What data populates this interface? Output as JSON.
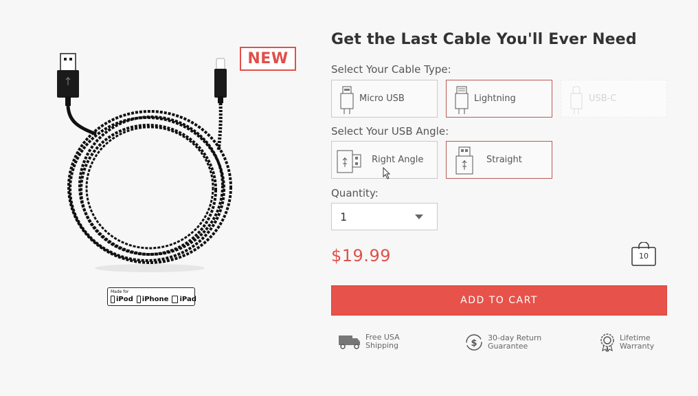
{
  "product": {
    "badge": "NEW",
    "mfi": {
      "small_text": "Made for",
      "ipod": "iPod",
      "iphone": "iPhone",
      "ipad": "iPad"
    },
    "title": "Get the Last Cable You'll Ever Need"
  },
  "cable_type": {
    "label": "Select Your Cable Type:",
    "options": [
      {
        "label": "Micro USB",
        "icon": "micro-usb-icon",
        "state": "normal"
      },
      {
        "label": "Lightning",
        "icon": "lightning-connector-icon",
        "state": "selected"
      },
      {
        "label": "USB-C",
        "icon": "usb-c-icon",
        "state": "disabled"
      }
    ]
  },
  "usb_angle": {
    "label": "Select Your USB Angle:",
    "options": [
      {
        "label": "Right Angle",
        "icon": "right-angle-usb-icon",
        "state": "normal"
      },
      {
        "label": "Straight",
        "icon": "straight-usb-icon",
        "state": "selected"
      }
    ]
  },
  "quantity": {
    "label": "Quantity:",
    "value": "1"
  },
  "price": "$19.99",
  "cart": {
    "count": "10"
  },
  "add_to_cart_label": "ADD TO CART",
  "features": [
    {
      "line1": "Free USA",
      "line2": "Shipping",
      "icon": "truck-icon"
    },
    {
      "line1": "30-day Return",
      "line2": "Guarantee",
      "icon": "money-back-icon"
    },
    {
      "line1": "Lifetime",
      "line2": "Warranty",
      "icon": "award-ribbon-icon"
    }
  ],
  "colors": {
    "accent": "#e7524a",
    "selected_border": "#b85a55",
    "text": "#333333"
  }
}
